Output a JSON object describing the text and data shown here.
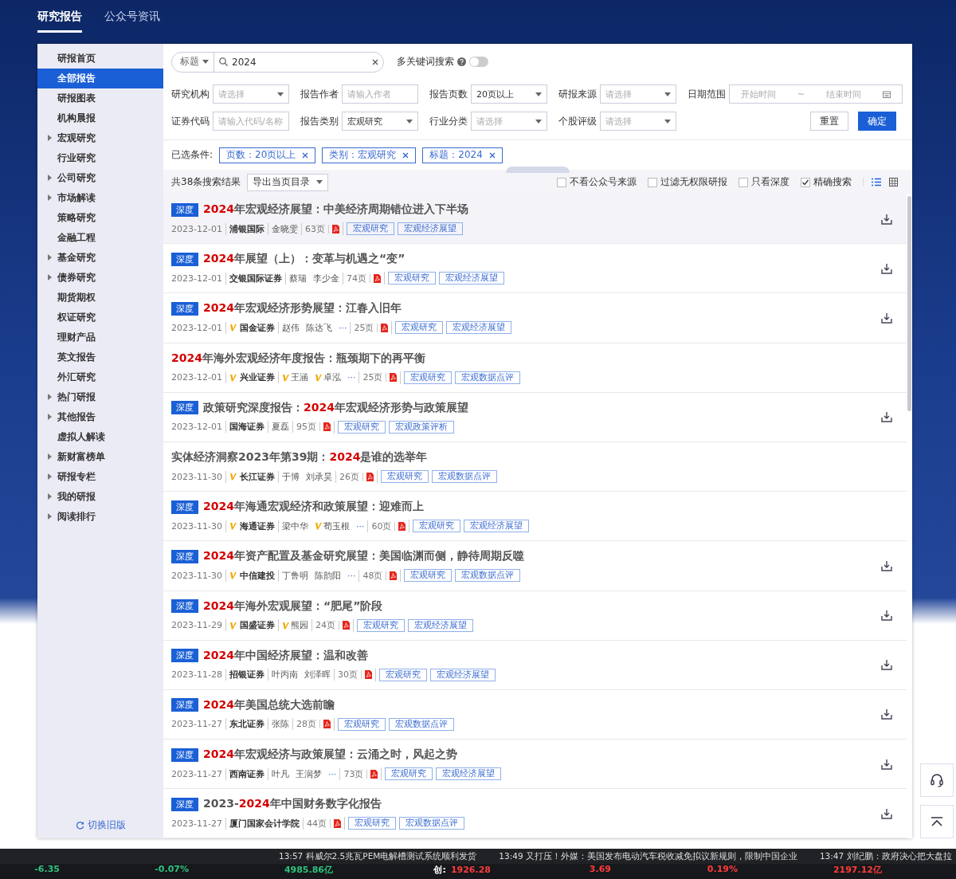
{
  "top_tabs": [
    {
      "label": "研究报告",
      "selected": true
    },
    {
      "label": "公众号资讯",
      "selected": false
    }
  ],
  "sidebar": {
    "items": [
      {
        "label": "研报首页",
        "selected": false,
        "expandable": false
      },
      {
        "label": "全部报告",
        "selected": true,
        "expandable": false
      },
      {
        "label": "研报图表",
        "selected": false,
        "expandable": false
      },
      {
        "label": "机构晨报",
        "selected": false,
        "expandable": false
      },
      {
        "label": "宏观研究",
        "selected": false,
        "expandable": true
      },
      {
        "label": "行业研究",
        "selected": false,
        "expandable": false
      },
      {
        "label": "公司研究",
        "selected": false,
        "expandable": true
      },
      {
        "label": "市场解读",
        "selected": false,
        "expandable": true
      },
      {
        "label": "策略研究",
        "selected": false,
        "expandable": false
      },
      {
        "label": "金融工程",
        "selected": false,
        "expandable": false
      },
      {
        "label": "基金研究",
        "selected": false,
        "expandable": true
      },
      {
        "label": "债券研究",
        "selected": false,
        "expandable": true
      },
      {
        "label": "期货期权",
        "selected": false,
        "expandable": false
      },
      {
        "label": "权证研究",
        "selected": false,
        "expandable": false
      },
      {
        "label": "理财产品",
        "selected": false,
        "expandable": false
      },
      {
        "label": "英文报告",
        "selected": false,
        "expandable": false
      },
      {
        "label": "外汇研究",
        "selected": false,
        "expandable": false
      },
      {
        "label": "热门研报",
        "selected": false,
        "expandable": true
      },
      {
        "label": "其他报告",
        "selected": false,
        "expandable": true
      },
      {
        "label": "虚拟人解读",
        "selected": false,
        "expandable": false
      },
      {
        "label": "新财富榜单",
        "selected": false,
        "expandable": true
      },
      {
        "label": "研报专栏",
        "selected": false,
        "expandable": true
      },
      {
        "label": "我的研报",
        "selected": false,
        "expandable": true
      },
      {
        "label": "阅读排行",
        "selected": false,
        "expandable": true
      }
    ],
    "footer_link": "切换旧版"
  },
  "search": {
    "scope": "标题",
    "value": "2024",
    "multi_keyword_label": "多关键词搜索",
    "multi_keyword_on": false
  },
  "filters": [
    [
      {
        "kind": "select",
        "label": "研究机构",
        "placeholder": "请选择"
      },
      {
        "kind": "input",
        "label": "报告作者",
        "placeholder": "请输入作者"
      },
      {
        "kind": "select",
        "label": "报告页数",
        "value": "20页以上"
      },
      {
        "kind": "select",
        "label": "研报来源",
        "placeholder": "请选择"
      },
      {
        "kind": "daterange",
        "label": "日期范围",
        "start_placeholder": "开始时间",
        "separator": "~",
        "end_placeholder": "结束时间"
      }
    ],
    [
      {
        "kind": "input",
        "label": "证券代码",
        "placeholder": "请输入代码/名称"
      },
      {
        "kind": "select",
        "label": "报告类别",
        "value": "宏观研究"
      },
      {
        "kind": "select",
        "label": "行业分类",
        "placeholder": "请选择"
      },
      {
        "kind": "select",
        "label": "个股评级",
        "placeholder": "请选择"
      }
    ]
  ],
  "filter_buttons": {
    "reset": "重置",
    "confirm": "确定"
  },
  "selected_conditions": {
    "label": "已选条件:",
    "chips": [
      "页数：20页以上",
      "类别：宏观研究",
      "标题：2024"
    ]
  },
  "toolbar": {
    "count": "共38条搜索结果",
    "export": "导出当页目录",
    "options": [
      {
        "label": "不看公众号来源",
        "checked": false
      },
      {
        "label": "过滤无权限研报",
        "checked": false
      },
      {
        "label": "只看深度",
        "checked": false
      },
      {
        "label": "精确搜索",
        "checked": true
      }
    ],
    "views": [
      {
        "kind": "list",
        "selected": true
      },
      {
        "kind": "grid",
        "selected": false
      }
    ]
  },
  "results": [
    {
      "selected": true,
      "badge": "深度",
      "title": [
        {
          "text": "2024",
          "highlight": true
        },
        {
          "text": "年宏观经济展望：中美经济周期错位进入下半场",
          "highlight": false
        }
      ],
      "date": "2023-12-01",
      "org": {
        "name": "浦银国际",
        "verified": false
      },
      "authors": [
        {
          "name": "金晓雯",
          "verified": false
        }
      ],
      "pages": "63页",
      "tags": [
        "宏观研究",
        "宏观经济展望"
      ],
      "downloadable": true
    },
    {
      "selected": false,
      "badge": "深度",
      "title": [
        {
          "text": "2024",
          "highlight": true
        },
        {
          "text": "年展望（上）：变革与机遇之“变”",
          "highlight": false
        }
      ],
      "date": "2023-12-01",
      "org": {
        "name": "交银国际证券",
        "verified": false
      },
      "authors": [
        {
          "name": "蔡瑞",
          "verified": false
        },
        {
          "name": "李少金",
          "verified": false
        }
      ],
      "pages": "74页",
      "tags": [
        "宏观研究",
        "宏观经济展望"
      ],
      "downloadable": true
    },
    {
      "selected": false,
      "badge": "深度",
      "title": [
        {
          "text": "2024",
          "highlight": true
        },
        {
          "text": "年宏观经济形势展望：江春入旧年",
          "highlight": false
        }
      ],
      "date": "2023-12-01",
      "org": {
        "name": "国金证券",
        "verified": true
      },
      "authors": [
        {
          "name": "赵伟",
          "verified": false
        },
        {
          "name": "陈达飞",
          "verified": false
        }
      ],
      "more": "···",
      "pages": "25页",
      "tags": [
        "宏观研究",
        "宏观经济展望"
      ],
      "downloadable": true
    },
    {
      "selected": false,
      "title": [
        {
          "text": "2024",
          "highlight": true
        },
        {
          "text": "年海外宏观经济年度报告：瓶颈期下的再平衡",
          "highlight": false
        }
      ],
      "date": "2023-12-01",
      "org": {
        "name": "兴业证券",
        "verified": true
      },
      "authors": [
        {
          "name": "王涵",
          "verified": true
        },
        {
          "name": "卓泓",
          "verified": true
        }
      ],
      "more": "···",
      "pages": "25页",
      "tags": [
        "宏观研究",
        "宏观数据点评"
      ],
      "downloadable": false
    },
    {
      "selected": false,
      "badge": "深度",
      "title": [
        {
          "text": "政策研究深度报告：",
          "highlight": false
        },
        {
          "text": "2024",
          "highlight": true
        },
        {
          "text": "年宏观经济形势与政策展望",
          "highlight": false
        }
      ],
      "date": "2023-12-01",
      "org": {
        "name": "国海证券",
        "verified": false
      },
      "authors": [
        {
          "name": "夏磊",
          "verified": false
        }
      ],
      "pages": "95页",
      "tags": [
        "宏观研究",
        "宏观政策评析"
      ],
      "downloadable": true
    },
    {
      "selected": false,
      "title": [
        {
          "text": "实体经济洞察2023年第39期：",
          "highlight": false
        },
        {
          "text": "2024",
          "highlight": true
        },
        {
          "text": "是谁的选举年",
          "highlight": false
        }
      ],
      "date": "2023-11-30",
      "org": {
        "name": "长江证券",
        "verified": true
      },
      "authors": [
        {
          "name": "于博",
          "verified": false
        },
        {
          "name": "刘承昊",
          "verified": false
        }
      ],
      "pages": "26页",
      "tags": [
        "宏观研究",
        "宏观数据点评"
      ],
      "downloadable": false
    },
    {
      "selected": false,
      "badge": "深度",
      "title": [
        {
          "text": "2024",
          "highlight": true
        },
        {
          "text": "年海通宏观经济和政策展望：迎难而上",
          "highlight": false
        }
      ],
      "date": "2023-11-30",
      "org": {
        "name": "海通证券",
        "verified": true
      },
      "authors": [
        {
          "name": "梁中华",
          "verified": false
        },
        {
          "name": "荀玉根",
          "verified": true
        }
      ],
      "more": "···",
      "pages": "60页",
      "tags": [
        "宏观研究",
        "宏观经济展望"
      ],
      "downloadable": false
    },
    {
      "selected": false,
      "badge": "深度",
      "title": [
        {
          "text": "2024",
          "highlight": true
        },
        {
          "text": "年资产配置及基金研究展望：美国临渊而侧，静待周期反噬",
          "highlight": false
        }
      ],
      "date": "2023-11-30",
      "org": {
        "name": "中信建投",
        "verified": true
      },
      "authors": [
        {
          "name": "丁鲁明",
          "verified": false
        },
        {
          "name": "陈韵阳",
          "verified": false
        }
      ],
      "more": "···",
      "pages": "48页",
      "tags": [
        "宏观研究",
        "宏观数据点评"
      ],
      "downloadable": true
    },
    {
      "selected": false,
      "badge": "深度",
      "title": [
        {
          "text": "2024",
          "highlight": true
        },
        {
          "text": "年海外宏观展望：“肥尾”阶段",
          "highlight": false
        }
      ],
      "date": "2023-11-29",
      "org": {
        "name": "国盛证券",
        "verified": true
      },
      "authors": [
        {
          "name": "熊园",
          "verified": true
        }
      ],
      "pages": "24页",
      "tags": [
        "宏观研究",
        "宏观经济展望"
      ],
      "downloadable": true
    },
    {
      "selected": false,
      "badge": "深度",
      "title": [
        {
          "text": "2024",
          "highlight": true
        },
        {
          "text": "年中国经济展望：温和改善",
          "highlight": false
        }
      ],
      "date": "2023-11-28",
      "org": {
        "name": "招银证券",
        "verified": false
      },
      "authors": [
        {
          "name": "叶丙南",
          "verified": false
        },
        {
          "name": "刘泽晖",
          "verified": false
        }
      ],
      "pages": "30页",
      "tags": [
        "宏观研究",
        "宏观经济展望"
      ],
      "downloadable": true
    },
    {
      "selected": false,
      "badge": "深度",
      "title": [
        {
          "text": "2024",
          "highlight": true
        },
        {
          "text": "年美国总统大选前瞻",
          "highlight": false
        }
      ],
      "date": "2023-11-27",
      "org": {
        "name": "东北证券",
        "verified": false
      },
      "authors": [
        {
          "name": "张陈",
          "verified": false
        }
      ],
      "pages": "28页",
      "tags": [
        "宏观研究",
        "宏观数据点评"
      ],
      "downloadable": true
    },
    {
      "selected": false,
      "badge": "深度",
      "title": [
        {
          "text": "2024",
          "highlight": true
        },
        {
          "text": "年宏观经济与政策展望：云涌之时，风起之势",
          "highlight": false
        }
      ],
      "date": "2023-11-27",
      "org": {
        "name": "西南证券",
        "verified": false
      },
      "authors": [
        {
          "name": "叶凡",
          "verified": false
        },
        {
          "name": "王润梦",
          "verified": false
        }
      ],
      "more": "···",
      "pages": "73页",
      "tags": [
        "宏观研究",
        "宏观经济展望"
      ],
      "downloadable": true
    },
    {
      "selected": false,
      "badge": "深度",
      "title": [
        {
          "text": "2023-",
          "highlight": false
        },
        {
          "text": "2024",
          "highlight": true
        },
        {
          "text": "年中国财务数字化报告",
          "highlight": false
        }
      ],
      "date": "2023-11-27",
      "org": {
        "name": "厦门国家会计学院",
        "verified": false
      },
      "pages": "44页",
      "tags": [
        "宏观研究",
        "宏观数据点评"
      ],
      "downloadable": true
    }
  ],
  "ticker": {
    "news": [
      {
        "time": "13:57",
        "text": "科威尔2.5兆瓦PEM电解槽测试系统顺利发货"
      },
      {
        "time": "13:49",
        "text": "又打压！外媒：美国发布电动汽车税收减免拟议新规则，限制中国企业"
      },
      {
        "time": "13:47",
        "text": "刘纪鹏：政府决心把大盘拉"
      }
    ],
    "quotes": [
      {
        "value": "-6.35",
        "color": "#2ec27e"
      },
      {
        "value": "-0.07%",
        "color": "#2ec27e"
      },
      {
        "value": "4985.86亿",
        "color": "#2ec27e"
      },
      {
        "label": "创:",
        "value": "1926.28",
        "color": "#ff3b3b"
      },
      {
        "value": "3.69",
        "color": "#ff3b3b"
      },
      {
        "value": "0.19%",
        "color": "#ff3b3b"
      },
      {
        "value": "2197.12亿",
        "color": "#ff3b3b"
      }
    ]
  }
}
